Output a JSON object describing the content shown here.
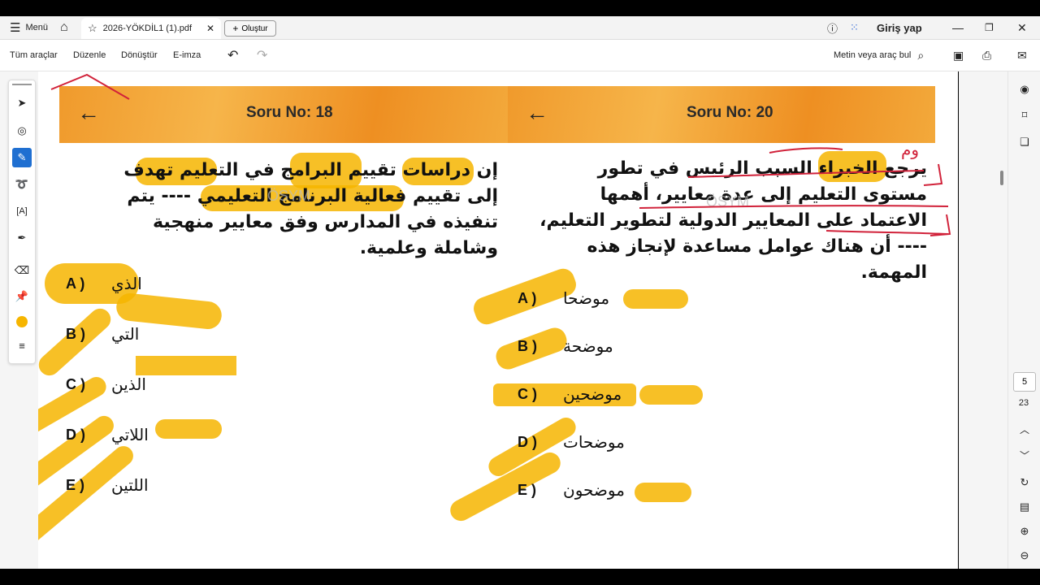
{
  "topbar": {
    "menu_label": "Menü",
    "tab_title": "2026-YÖKDİL1 (1).pdf",
    "new_button": "Oluştur",
    "signin": "Giriş yap"
  },
  "toolbar": {
    "all_tools": "Tüm araçlar",
    "edit": "Düzenle",
    "convert": "Dönüştür",
    "esign": "E-imza",
    "search_label": "Metin veya araç bul"
  },
  "page_nav": {
    "current": "5",
    "total": "23"
  },
  "left_question": {
    "title": "Soru No: 18",
    "text": "إن دراسات تقييم البرامج في التعليم تهدف إلى تقييم فعالية البرنامج التعليمي ---- يتم تنفيذه في المدارس وفق معايير منهجية وشاملة وعلمية.",
    "watermark": "ÖSYM",
    "options": [
      {
        "label": "A )",
        "text": "الذي"
      },
      {
        "label": "B )",
        "text": "التي"
      },
      {
        "label": "C )",
        "text": "الذين"
      },
      {
        "label": "D )",
        "text": "اللاتي"
      },
      {
        "label": "E )",
        "text": "اللتين"
      }
    ]
  },
  "right_question": {
    "title": "Soru No: 20",
    "text": "يرجع الخبراء السبب الرئيس في تطور مستوى التعليم إلى عدة معايير، أهمها الاعتماد على المعايير الدولية لتطوير التعليم، ---- أن هناك عوامل مساعدة لإنجاز هذه المهمة.",
    "watermark": "ÖSYM",
    "annotation": "وم",
    "options": [
      {
        "label": "A )",
        "text": "موضحا"
      },
      {
        "label": "B )",
        "text": "موضحة"
      },
      {
        "label": "C )",
        "text": "موضحين"
      },
      {
        "label": "D )",
        "text": "موضحات"
      },
      {
        "label": "E )",
        "text": "موضحون"
      }
    ]
  },
  "colors": {
    "highlight": "#f6b500",
    "ink_red": "#d1223a",
    "banner": "#f09a2c"
  }
}
